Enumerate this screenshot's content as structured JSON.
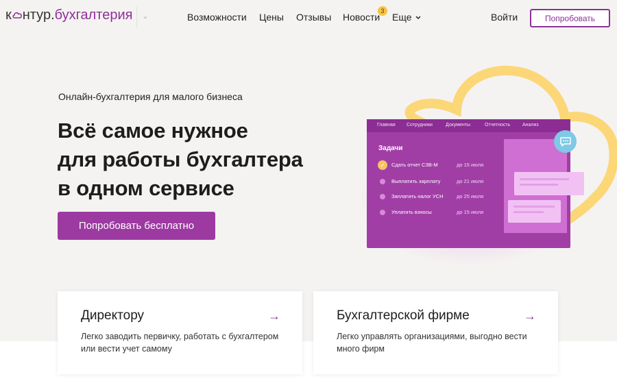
{
  "header": {
    "logo": {
      "prefix": "к",
      "suffix": "нтур.",
      "brand": "бухгалтерия"
    },
    "nav": [
      {
        "label": "Возможности"
      },
      {
        "label": "Цены"
      },
      {
        "label": "Отзывы"
      },
      {
        "label": "Новости",
        "badge": "3"
      },
      {
        "label": "Еще"
      }
    ],
    "login_label": "Войти",
    "try_label": "Попробовать"
  },
  "hero": {
    "subtitle": "Онлайн-бухгалтерия для малого бизнеса",
    "headline": [
      "Всё самое нужное",
      "для работы бухгалтера",
      "в одном сервисе"
    ],
    "cta_label": "Попробовать бесплатно"
  },
  "app_preview": {
    "tabs": [
      "Главная",
      "Сотрудники",
      "Документы",
      "Отчетность",
      "Анализ"
    ],
    "tasks_title": "Задачи",
    "tasks": [
      {
        "name": "Сдать отчет СЗВ-М",
        "due": "до 15 июля",
        "done": true
      },
      {
        "name": "Выплатить зарплату",
        "due": "до 21 июля",
        "done": false
      },
      {
        "name": "Заплатить налог УСН",
        "due": "до 25 июля",
        "done": false
      },
      {
        "name": "Уплатить взносы",
        "due": "до 15 июля",
        "done": false
      }
    ]
  },
  "cards": [
    {
      "title": "Директору",
      "desc": "Легко заводить первичку, работать с бухгалтером или вести учет самому",
      "arrow": "→"
    },
    {
      "title": "Бухгалтерской фирме",
      "desc": "Легко управлять организациями, выгодно вести много фирм",
      "arrow": "→"
    }
  ],
  "colors": {
    "brand": "#8e2f9a",
    "cta": "#9c3aa2",
    "accent_yellow": "#fbd778",
    "app_bg": "#a13ea6"
  }
}
